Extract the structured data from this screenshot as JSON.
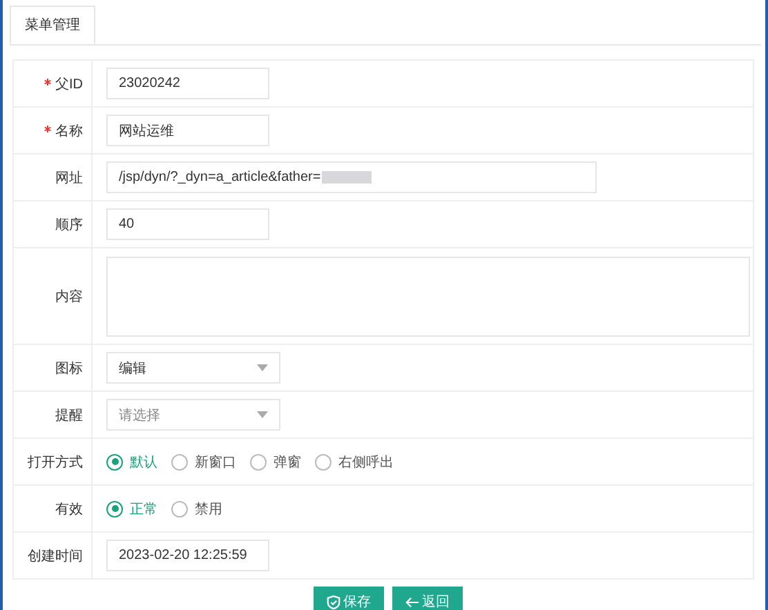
{
  "tabs": [
    {
      "label": "菜单管理",
      "selected": true
    }
  ],
  "fields": [
    {
      "kind": "text",
      "label": "父ID",
      "required": true,
      "value": "23020242"
    },
    {
      "kind": "text",
      "label": "名称",
      "required": true,
      "value": "网站运维"
    },
    {
      "kind": "url",
      "label": "网址",
      "required": false,
      "value": "/jsp/dyn/?_dyn=a_article&father="
    },
    {
      "kind": "text",
      "label": "顺序",
      "required": false,
      "value": "40"
    },
    {
      "kind": "textarea",
      "label": "内容",
      "required": false
    },
    {
      "kind": "select",
      "label": "图标",
      "required": false,
      "value": "编辑"
    },
    {
      "kind": "select",
      "label": "提醒",
      "required": false,
      "placeholder": "请选择"
    },
    {
      "kind": "radio",
      "label": "打开方式",
      "required": false,
      "options": [
        {
          "label": "默认",
          "selected": true
        },
        {
          "label": "新窗口",
          "selected": false
        },
        {
          "label": "弹窗",
          "selected": false
        },
        {
          "label": "右侧呼出",
          "selected": false
        }
      ]
    },
    {
      "kind": "radio",
      "label": "有效",
      "required": false,
      "options": [
        {
          "label": "正常",
          "selected": true
        },
        {
          "label": "禁用",
          "selected": false
        }
      ]
    },
    {
      "kind": "text",
      "label": "创建时间",
      "required": false,
      "value": "2023-02-20 12:25:59"
    }
  ],
  "buttons": [
    {
      "kind": "save",
      "label": "保存"
    },
    {
      "kind": "back",
      "label": "返回"
    }
  ]
}
